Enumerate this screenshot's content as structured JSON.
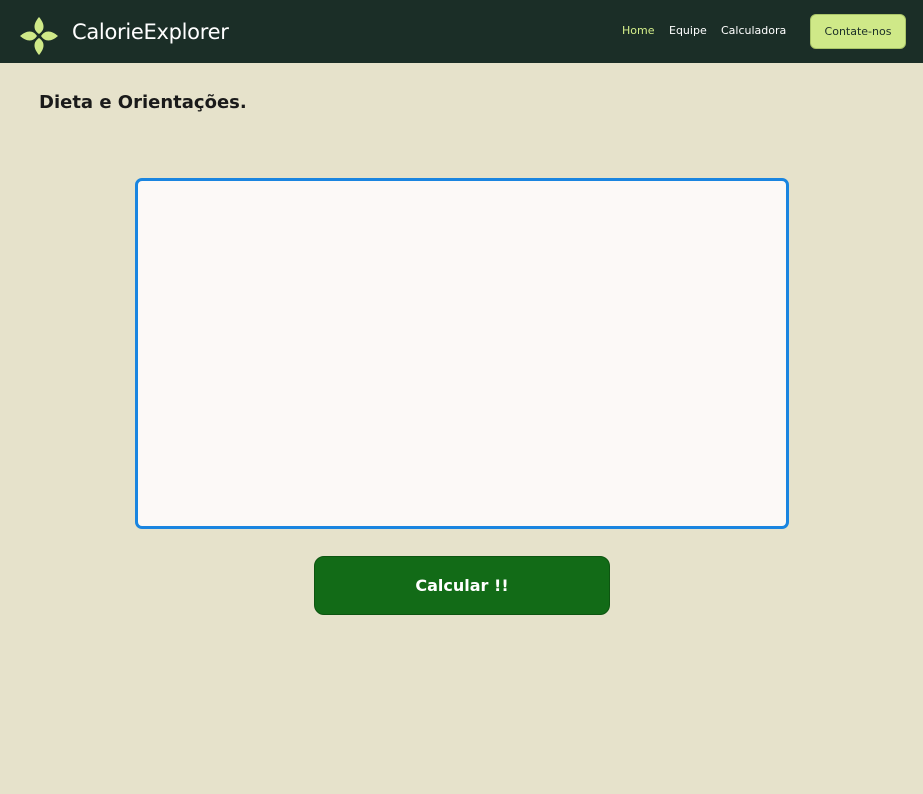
{
  "header": {
    "brand": "CalorieExplorer",
    "logo_icon": "four-leaf-logo-icon",
    "nav": [
      {
        "label": "Home",
        "active": true
      },
      {
        "label": "Equipe",
        "active": false
      },
      {
        "label": "Calculadora",
        "active": false
      }
    ],
    "contact_label": "Contate-nos"
  },
  "main": {
    "title": "Dieta e Orientações.",
    "textarea_value": "",
    "calculate_label": "Calcular !!"
  },
  "colors": {
    "navbar_bg": "#1b2e27",
    "page_bg": "#e6e2cb",
    "accent": "#cfe988",
    "active_link": "#d4ee8a",
    "button_green": "#126b17",
    "focus_border": "#1a85e0"
  }
}
